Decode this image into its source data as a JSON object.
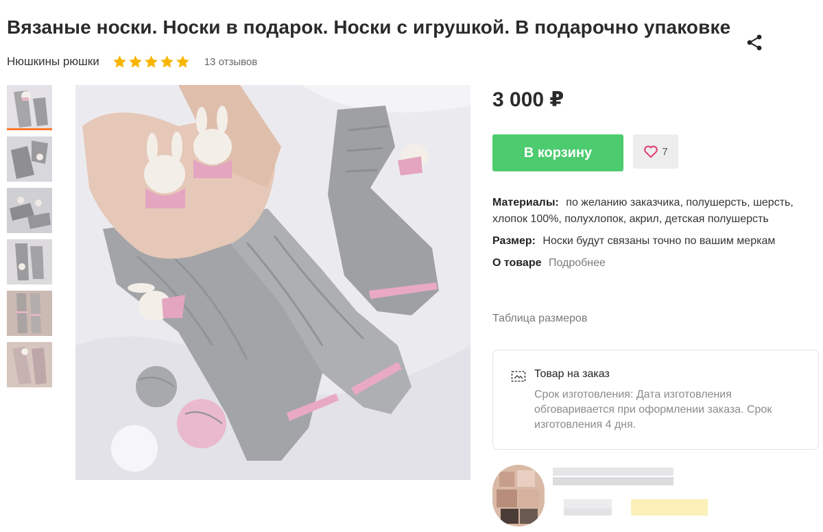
{
  "product": {
    "title": "Вязаные носки. Носки в подарок. Носки с игрушкой. В подарочно упаковке",
    "price": "3 000 ₽"
  },
  "seller": {
    "name": "Нюшкины рюшки",
    "rating": 5,
    "reviews": "13 отзывов"
  },
  "actions": {
    "cart_label": "В корзину",
    "favorites_count": "7"
  },
  "properties": {
    "materials_label": "Материалы:",
    "materials_value": "по желанию заказчика, полушерсть, шерсть, хлопок 100%, полухлопок, акрил, детская полушерсть",
    "size_label": "Размер:",
    "size_value": "Носки будут связаны точно по вашим меркам",
    "about_label": "О товаре",
    "about_link": "Подробнее",
    "size_table_link": "Таблица размеров"
  },
  "order": {
    "title": "Товар на заказ",
    "description": "Срок изготовления: Дата изготовления обговаривается при оформлении заказа. Срок изготовления 4 дня."
  },
  "colors": {
    "accent_green": "#4dcb6f",
    "star": "#f7b500",
    "active_thumb": "#ff7a29"
  },
  "icons": {
    "share": "share-icon",
    "heart": "heart-icon",
    "order": "made-to-order-icon"
  }
}
